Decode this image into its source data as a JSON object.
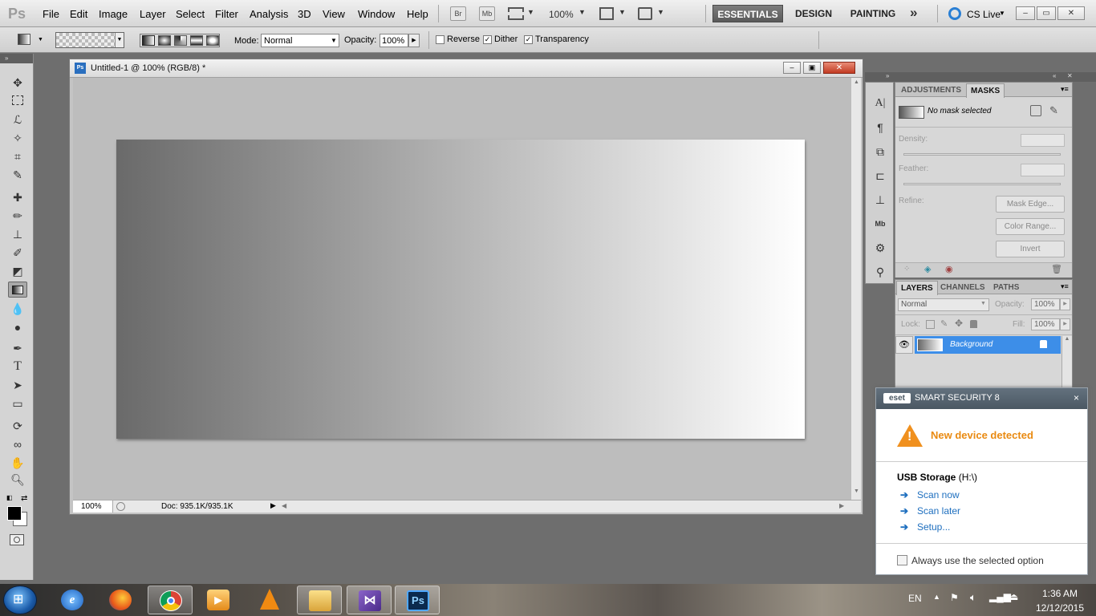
{
  "menubar": {
    "app_logo": "Ps",
    "menus": [
      "File",
      "Edit",
      "Image",
      "Layer",
      "Select",
      "Filter",
      "Analysis",
      "3D",
      "View",
      "Window",
      "Help"
    ],
    "bridge_label": "Br",
    "minibridge_label": "Mb",
    "zoom": "100%",
    "workspaces": [
      "ESSENTIALS",
      "DESIGN",
      "PAINTING"
    ],
    "more_workspaces": "»",
    "cs_live": "CS Live",
    "window_controls": [
      "–",
      "▭",
      "✕"
    ]
  },
  "options": {
    "mode_label": "Mode:",
    "mode_value": "Normal",
    "opacity_label": "Opacity:",
    "opacity_value": "100%",
    "reverse_label": "Reverse",
    "dither_label": "Dither",
    "transparency_label": "Transparency",
    "reverse_checked": false,
    "dither_checked": true,
    "transparency_checked": true
  },
  "document": {
    "title": "Untitled-1 @ 100% (RGB/8) *",
    "zoom": "100%",
    "doc_info": "Doc: 935.1K/935.1K",
    "gradient_start": "#6a6a6a",
    "gradient_end": "#ffffff"
  },
  "adjustments_panel": {
    "tabs": [
      "ADJUSTMENTS",
      "MASKS"
    ],
    "no_mask": "No mask selected",
    "density_label": "Density:",
    "feather_label": "Feather:",
    "refine_label": "Refine:",
    "buttons": [
      "Mask Edge...",
      "Color Range...",
      "Invert"
    ]
  },
  "layers_panel": {
    "tabs": [
      "LAYERS",
      "CHANNELS",
      "PATHS"
    ],
    "blend_mode": "Normal",
    "opacity_label": "Opacity:",
    "opacity_value": "100%",
    "lock_label": "Lock:",
    "fill_label": "Fill:",
    "fill_value": "100%",
    "layers": [
      {
        "name": "Background"
      }
    ],
    "selected_color": "#3d8ee8"
  },
  "eset": {
    "logo": "eset",
    "title": "SMART SECURITY 8",
    "close": "×",
    "headline": "New device detected",
    "device_name": "USB Storage",
    "device_drive": "(H:\\)",
    "actions": [
      "Scan now",
      "Scan later",
      "Setup..."
    ],
    "always_label": "Always use the selected option",
    "accent": "#e98a11",
    "link_color": "#1e6fbf"
  },
  "taskbar": {
    "language": "EN",
    "time": "1:36 AM",
    "date": "12/12/2015",
    "ps_label": "Ps"
  }
}
